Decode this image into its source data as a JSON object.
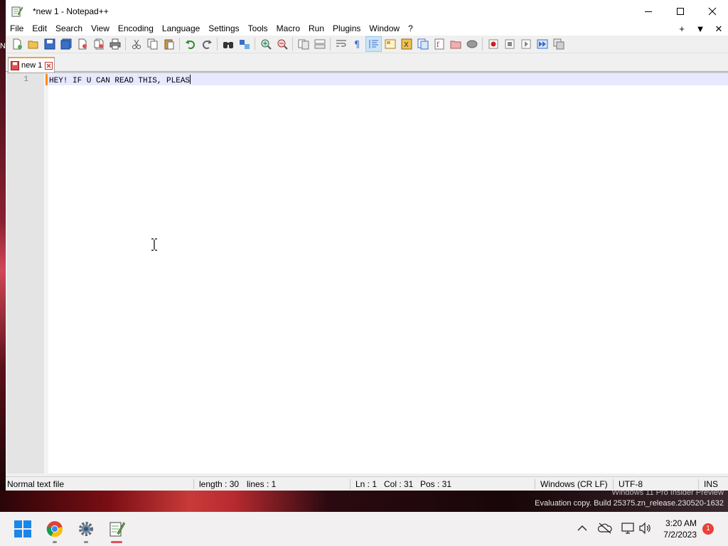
{
  "desktop": {
    "left_label": "N",
    "watermark_line1": "Windows 11 Pro Insider Preview",
    "watermark_line2": "Evaluation copy. Build 25375.zn_release.230520-1632"
  },
  "window": {
    "title": "*new 1 - Notepad++",
    "minimize": "—",
    "maximize": "☐",
    "close": "✕"
  },
  "menu": {
    "items": [
      "File",
      "Edit",
      "Search",
      "View",
      "Encoding",
      "Language",
      "Settings",
      "Tools",
      "Macro",
      "Run",
      "Plugins",
      "Window",
      "?"
    ],
    "right": [
      "+",
      "▼",
      "✕"
    ]
  },
  "tab": {
    "label": "new 1"
  },
  "editor": {
    "line_number": "1",
    "line_text": "HEY! IF U CAN READ THIS, PLEAS"
  },
  "status": {
    "file_type": "Normal text file",
    "length": "length : 30",
    "lines": "lines : 1",
    "ln": "Ln : 1",
    "col": "Col : 31",
    "pos": "Pos : 31",
    "eol": "Windows (CR LF)",
    "encoding": "UTF-8",
    "mode": "INS"
  },
  "taskbar": {
    "time": "3:20 AM",
    "date": "7/2/2023",
    "notification_count": "1"
  }
}
